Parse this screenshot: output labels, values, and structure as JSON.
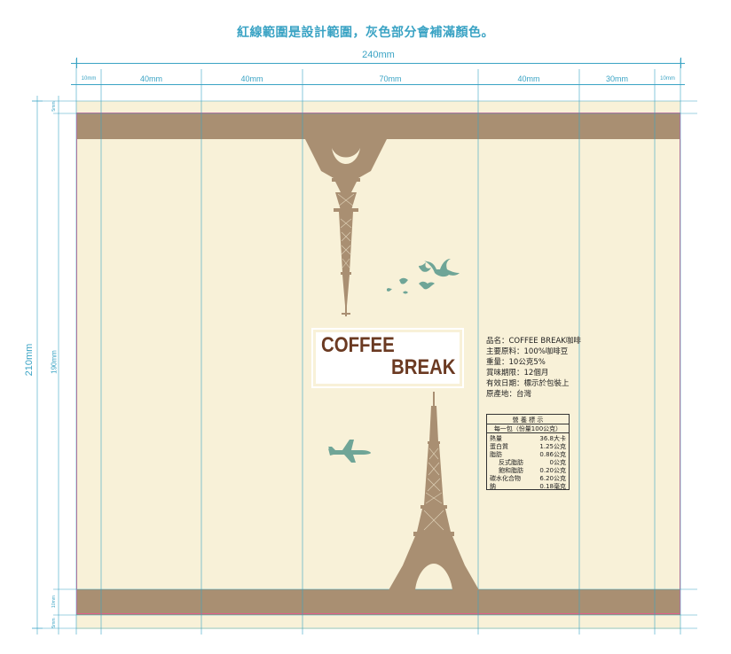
{
  "title": "紅線範圍是設計範圍，灰色部分會補滿顏色。",
  "dims": {
    "total_width": "240mm",
    "segments": [
      "10mm",
      "40mm",
      "40mm",
      "70mm",
      "40mm",
      "30mm",
      "10mm"
    ],
    "total_height": "210mm",
    "inner_height": "190mm",
    "v_small_a": "5mm",
    "v_small_b": "10mm",
    "v_small_c": "5mm"
  },
  "logo": {
    "line1": "COFFEE",
    "line2": "BREAK"
  },
  "product_info": [
    "品名：COFFEE BREAK咖啡",
    "主要原料：100%咖啡豆",
    "重量：10公克5%",
    "賞味期限：12個月",
    "有效日期：標示於包裝上",
    "原產地：台灣"
  ],
  "nutrition": {
    "title": "營 養 標 示",
    "subtitle": "每一包（份量100公克）",
    "rows": [
      {
        "name": "熱量",
        "value": "36.8大卡"
      },
      {
        "name": "蛋白質",
        "value": "1.25公克"
      },
      {
        "name": "脂肪",
        "value": "0.86公克"
      },
      {
        "name": "反式脂肪",
        "value": "0公克"
      },
      {
        "name": "飽和脂肪",
        "value": "0.20公克"
      },
      {
        "name": "碳水化合物",
        "value": "6.20公克"
      },
      {
        "name": "鈉",
        "value": "0.18毫克"
      }
    ]
  },
  "colors": {
    "background": "#f8f1d8",
    "band": "#a98f72",
    "guide": "#3aa3c4",
    "bleed": "#e0608a",
    "tower": "#a98f72",
    "accent": "#6fa597",
    "logo_text": "#6b3a22"
  },
  "icons": [
    "eiffel-tower-icon",
    "bird-icon",
    "airplane-icon"
  ]
}
